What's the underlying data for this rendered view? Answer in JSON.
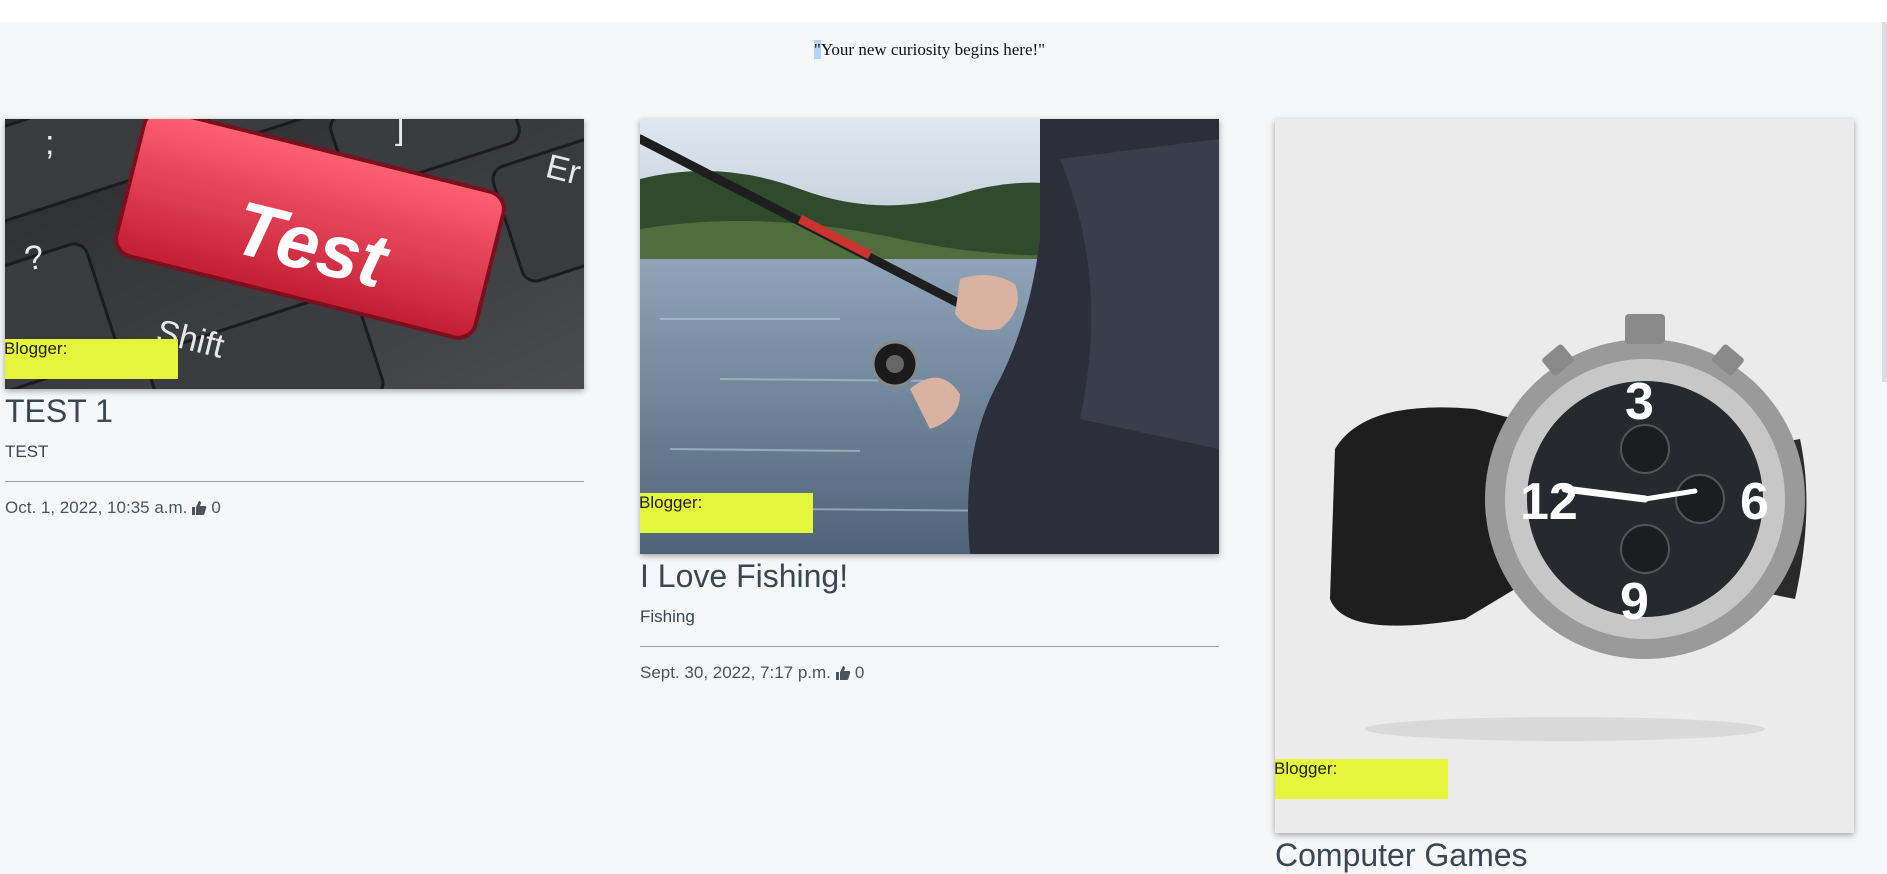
{
  "header": {
    "quote_open": "\"",
    "quote_text": "Your new curiosity begins here!\""
  },
  "posts": [
    {
      "image_icon": "keyboard-test-key-photo",
      "key_label": "Test",
      "blogger_label": "Blogger:",
      "title": "TEST 1",
      "category": "TEST",
      "date": "Oct. 1, 2022, 10:35 a.m.",
      "likes": "0"
    },
    {
      "image_icon": "fishing-rod-lake-photo",
      "blogger_label": "Blogger:",
      "title": "I Love Fishing!",
      "category": "Fishing",
      "date": "Sept. 30, 2022, 7:17 p.m.",
      "likes": "0"
    },
    {
      "image_icon": "wristwatch-photo",
      "blogger_label": "Blogger:",
      "title": "Computer Games"
    }
  ],
  "colors": {
    "badge": "#e4f53b",
    "page_background": "#f6f7f9",
    "text": "#3b4650"
  }
}
